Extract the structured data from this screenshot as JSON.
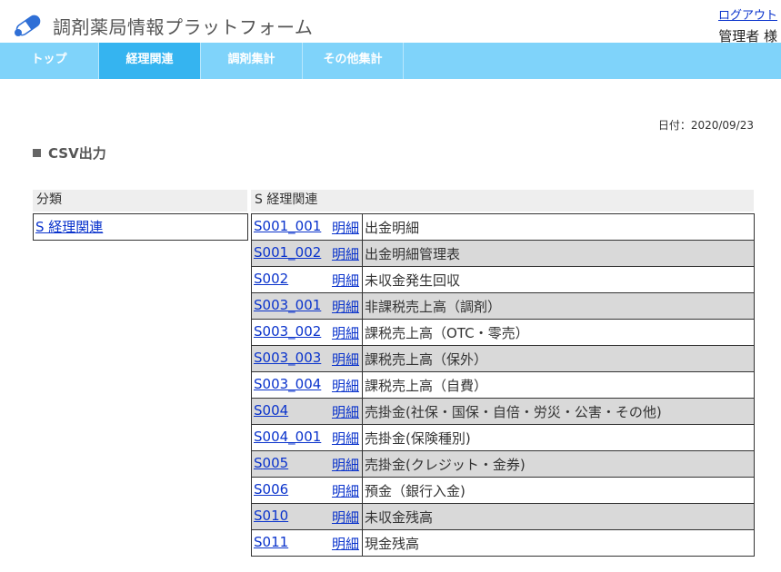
{
  "header": {
    "app_title": "調剤薬局情報プラットフォーム",
    "logout_label": "ログアウト",
    "user_label": "管理者 様",
    "logo_icon": "capsule-icon",
    "logo_colors": [
      "#2f6fd6",
      "#ffffff"
    ]
  },
  "nav": {
    "tabs": [
      {
        "label": "トップ",
        "active": false
      },
      {
        "label": "経理関連",
        "active": true
      },
      {
        "label": "調剤集計",
        "active": false
      },
      {
        "label": "その他集計",
        "active": false
      }
    ]
  },
  "page": {
    "date_text": "日付：2020/09/23",
    "section_title": "CSV出力"
  },
  "category_panel": {
    "header": "分類",
    "selected": "S 経理関連"
  },
  "list_panel": {
    "header": "S 経理関連",
    "rows": [
      {
        "code": "S001_001",
        "type": "明細",
        "name": "出金明細"
      },
      {
        "code": "S001_002",
        "type": "明細",
        "name": "出金明細管理表"
      },
      {
        "code": "S002",
        "type": "明細",
        "name": "未収金発生回収"
      },
      {
        "code": "S003_001",
        "type": "明細",
        "name": "非課税売上高（調剤）"
      },
      {
        "code": "S003_002",
        "type": "明細",
        "name": "課税売上高（OTC・零売）"
      },
      {
        "code": "S003_003",
        "type": "明細",
        "name": "課税売上高（保外）"
      },
      {
        "code": "S003_004",
        "type": "明細",
        "name": "課税売上高（自費）"
      },
      {
        "code": "S004",
        "type": "明細",
        "name": "売掛金(社保・国保・自倍・労災・公害・その他)"
      },
      {
        "code": "S004_001",
        "type": "明細",
        "name": "売掛金(保険種別)"
      },
      {
        "code": "S005",
        "type": "明細",
        "name": "売掛金(クレジット・金券)"
      },
      {
        "code": "S006",
        "type": "明細",
        "name": "預金（銀行入金)"
      },
      {
        "code": "S010",
        "type": "明細",
        "name": "未収金残高"
      },
      {
        "code": "S011",
        "type": "明細",
        "name": "現金残高"
      }
    ]
  },
  "colors": {
    "nav_bg": "#7fd3fa",
    "nav_active": "#35b4f0",
    "link": "#0a33cc",
    "alt_row": "#d9d9d9"
  }
}
